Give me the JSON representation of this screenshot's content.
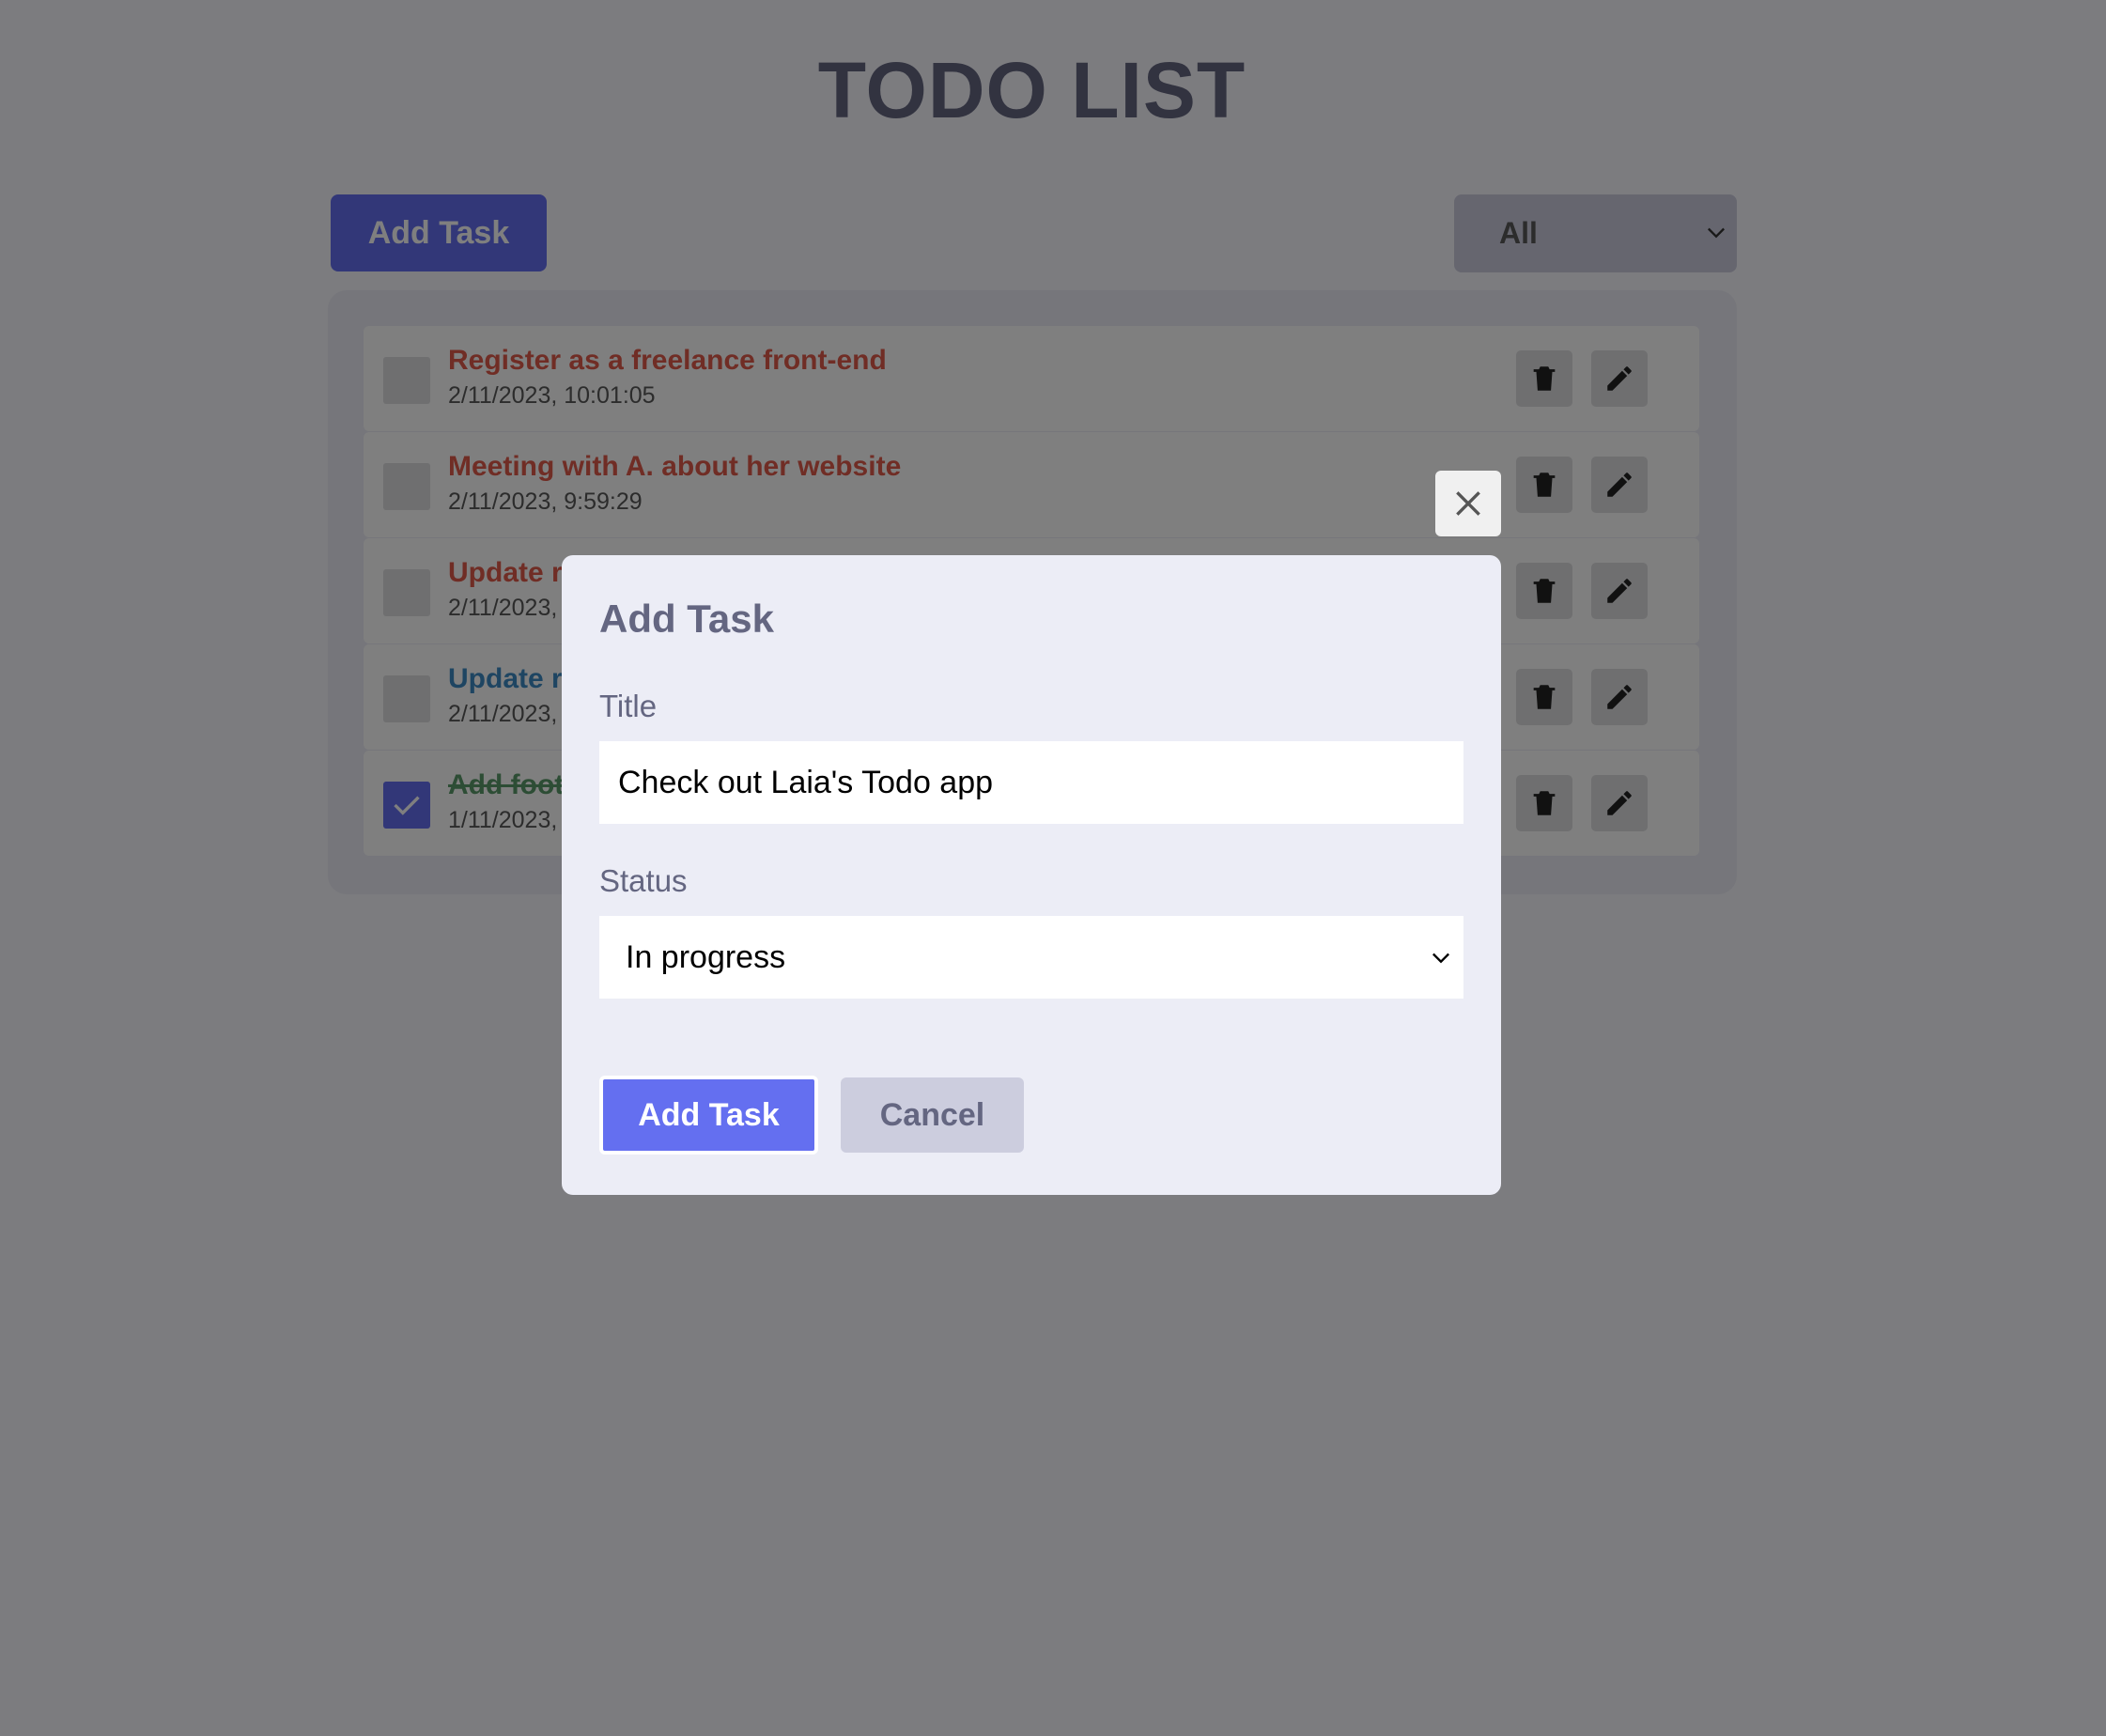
{
  "app": {
    "title": "TODO LIST",
    "add_task_label": "Add Task",
    "filter_value": "All"
  },
  "tasks": [
    {
      "title": "Register as a freelance front-end",
      "date": "2/11/2023, 10:01:05",
      "status": "incomplete",
      "color": "#e05a4a",
      "completed": false
    },
    {
      "title": "Meeting with A. about her website",
      "date": "2/11/2023, 9:59:29",
      "status": "incomplete",
      "color": "#e05a4a",
      "completed": false
    },
    {
      "title": "Update r",
      "date": "2/11/2023,",
      "status": "incomplete",
      "color": "#e05a4a",
      "completed": false
    },
    {
      "title": "Update r",
      "date": "2/11/2023,",
      "status": "in progress",
      "color": "#3d8ac4",
      "completed": false
    },
    {
      "title": "Add foot",
      "date": "1/11/2023, 1",
      "status": "complete",
      "color": "#5a9a6a",
      "completed": true
    }
  ],
  "modal": {
    "heading": "Add Task",
    "title_label": "Title",
    "title_value": "Check out Laia's Todo app",
    "status_label": "Status",
    "status_value": "In progress",
    "submit_label": "Add Task",
    "cancel_label": "Cancel"
  },
  "icons": {
    "close": "close-icon",
    "delete": "trash-icon",
    "edit": "pencil-icon",
    "checkmark": "checkmark-icon",
    "dropdown": "chevron-down-icon"
  },
  "colors": {
    "accent": "#646ff0",
    "text_muted": "#646681",
    "panel_bg": "#ecedf6",
    "button_secondary": "#cccdde"
  }
}
